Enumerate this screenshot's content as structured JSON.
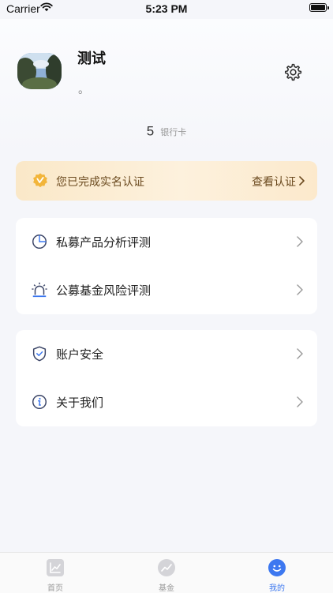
{
  "status_bar": {
    "carrier": "Carrier",
    "time": "5:23 PM"
  },
  "profile": {
    "name": "测试",
    "subtitle": "。"
  },
  "stats": {
    "bank_card_count": "5",
    "bank_card_label": "银行卡"
  },
  "verification": {
    "message": "您已完成实名认证",
    "link": "查看认证",
    "color": "#6b4a1f"
  },
  "menu_group_1": [
    {
      "label": "私募产品分析评测",
      "icon": "pie-chart-icon"
    },
    {
      "label": "公募基金风险评测",
      "icon": "alarm-light-icon"
    }
  ],
  "menu_group_2": [
    {
      "label": "账户安全",
      "icon": "shield-check-icon"
    },
    {
      "label": "关于我们",
      "icon": "info-icon"
    }
  ],
  "tabbar": {
    "accent": "#3d78f0",
    "items": [
      {
        "label": "首页",
        "icon": "chart-icon",
        "active": false
      },
      {
        "label": "基金",
        "icon": "trend-icon",
        "active": false
      },
      {
        "label": "我的",
        "icon": "smile-icon",
        "active": true
      }
    ]
  }
}
